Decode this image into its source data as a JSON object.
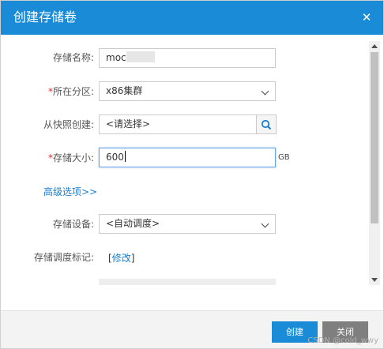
{
  "dialog": {
    "title": "创建存储卷"
  },
  "form": {
    "name": {
      "label": "存储名称:",
      "value": "moc"
    },
    "partition": {
      "label": "所在分区:",
      "required_mark": "*",
      "value": "x86集群"
    },
    "snapshot": {
      "label": "从快照创建:",
      "value": "<请选择>"
    },
    "size": {
      "label": "存储大小:",
      "required_mark": "*",
      "value": "600",
      "unit": "GB"
    },
    "advanced_link": "高级选项>>",
    "device": {
      "label": "存储设备:",
      "value": "<自动调度>"
    },
    "scheduling": {
      "label": "存储调度标记:",
      "bracket_open": "[",
      "link": "修改",
      "bracket_close": "]"
    }
  },
  "footer": {
    "create_label": "创建",
    "close_label": "关闭",
    "watermark": "CSDN @cold_wwy"
  },
  "colors": {
    "accent": "#1a8bd6",
    "required": "#e02b2b",
    "link": "#1a7fd0",
    "close_button": "#7f7f7f"
  }
}
